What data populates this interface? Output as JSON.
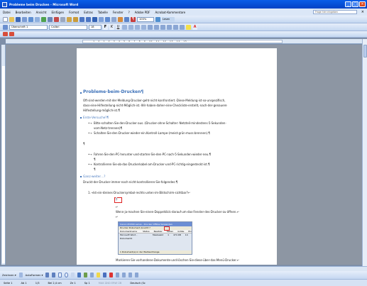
{
  "window": {
    "title": "Probleme beim Drucken - Microsoft Word"
  },
  "menu": [
    "Datei",
    "Bearbeiten",
    "Ansicht",
    "Einfügen",
    "Format",
    "Extras",
    "Tabelle",
    "Fenster",
    "?",
    "Adobe PDF",
    "Acrobat-Kommentare"
  ],
  "help_placeholder": "Frage hier eingeben",
  "toolbar": {
    "zoom": "100%",
    "read_label": "Lesen",
    "style": "Überschrift 1",
    "font": "Calibri",
    "size": "18"
  },
  "document": {
    "title": "Probleme·beim·Drucken¶",
    "intro": [
      "Oft·sind·werden·mit·der·Meldung·Drucker·geht·nicht·konfrontiert.·Diese·Meldung·ist·so·unspezifisch,",
      "dass·eine·Hilfestellung·nicht·Möglich·ist.·Wir·haben·daher·eine·Checkliste·erstellt,·nach·der·genauere",
      "Hilfestellung·möglich·ist.¶"
    ],
    "section1": "Erste·Versuche?¶",
    "bullets1": [
      [
        "Bitte·schalten·Sie·den·Drucker·aus.·(Drucker·ohne·Schalter:·Netzteil·mindestens·5·Sekunden·",
        "vom·Netz·trennen)¶"
      ],
      [
        "Schalten·Sie·den·Drucker·wieder·ein.Kontroll-Lampe·(meist·grün·muss·brennen).¶"
      ],
      [
        "Fahren·Sie·den·PC·herunter·und·starten·Sie·den·PC·nach·5·Sekunden·wieder·neu.¶"
      ],
      [
        "Kontrollieren·Sie·ob·das·Druckerkabel·am·Drucker·und·PC·richtig·eingesteckt·ist.¶"
      ]
    ],
    "pilcrow": "¶",
    "section2": "Ganz·weiter…?",
    "para2": "Druckt·der·Drucker·immer·noch·nicht·kontrollieren·Sie·folgendes:¶",
    "item1": "1.→Ist·ein·kleines·Druckersymbol·rechts·unten·im·Bildschirm·sichtbar?↵",
    "para3": "Wenn·ja·machen·Sie·einen·Doppelklick·darauf·um·das·Fenster·des·Drucker·zu·öffnen.↵",
    "para4": "Markieren·Sie·vorhandene·Dokumente·und·löschen·Sie·diese·über·das·Menü·Drucker.↵"
  },
  "embedded_window": {
    "title": "Canon iP4300 series - Drucker Offline Verwenden",
    "menu": "Drucker   Dokument   Ansicht   ?",
    "headers": [
      "Dokumentname",
      "Status",
      "Besitzer",
      "Seiten",
      "Größe",
      "Ein"
    ],
    "row": [
      "Microsoft Word - Dokument1",
      "",
      "Maxbwald",
      "1",
      "474 KB",
      "14"
    ],
    "footer": "1 Dokument(e) in der Warteschlange"
  },
  "drawbar": {
    "zeichnen": "Zeichnen ▾",
    "autoformen": "AutoFormen ▾"
  },
  "status": {
    "page": "Seite 1",
    "section": "Ab 1",
    "of": "1/3",
    "at": "Bei 2,4 cm",
    "line": "Ze 1",
    "col": "Sp 1",
    "rec": "MAK ÄND ERW ÜB",
    "lang": "Deutsch (Sc"
  },
  "colors": {
    "heading": "#3d71b8",
    "titlebar": "#0a5ee8"
  }
}
